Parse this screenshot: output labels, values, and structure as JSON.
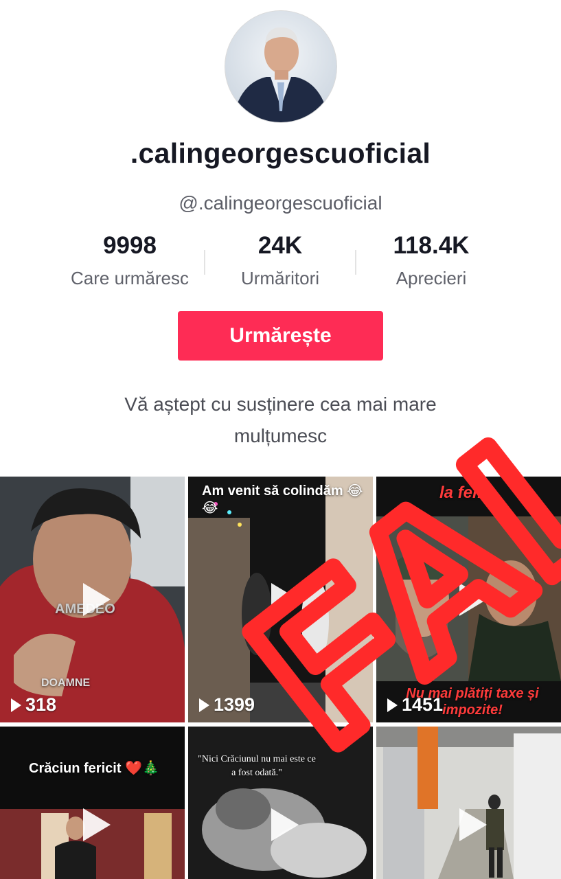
{
  "profile": {
    "display_name": ".calingeorgescuoficial",
    "handle": "@.calingeorgescuoficial",
    "bio_line1": "Vă aștept cu susținere cea mai mare",
    "bio_line2": "mulțumesc"
  },
  "stats": [
    {
      "value": "9998",
      "label": "Care urmăresc"
    },
    {
      "value": "24K",
      "label": "Urmăritori"
    },
    {
      "value": "118.4K",
      "label": "Aprecieri"
    }
  ],
  "follow_button": {
    "label": "Urmărește",
    "color": "#fe2c55"
  },
  "videos": [
    {
      "views": "318",
      "overlay": "AMEDEO",
      "caption": "DOAMNE"
    },
    {
      "views": "1399",
      "overlay": "Am venit să colindăm 😂😂"
    },
    {
      "views": "1451",
      "overlay": "la fel!",
      "caption": "Nu mai plătiți taxe și impozite!"
    },
    {
      "overlay": "Crăciun fericit ❤️🎄"
    },
    {
      "overlay": "\"Nici Crăciunul nu mai este ce a fost odată.\""
    },
    {
      "overlay": ""
    }
  ],
  "watermark": {
    "text": "FALS!!!",
    "color": "#ff2a2a"
  }
}
